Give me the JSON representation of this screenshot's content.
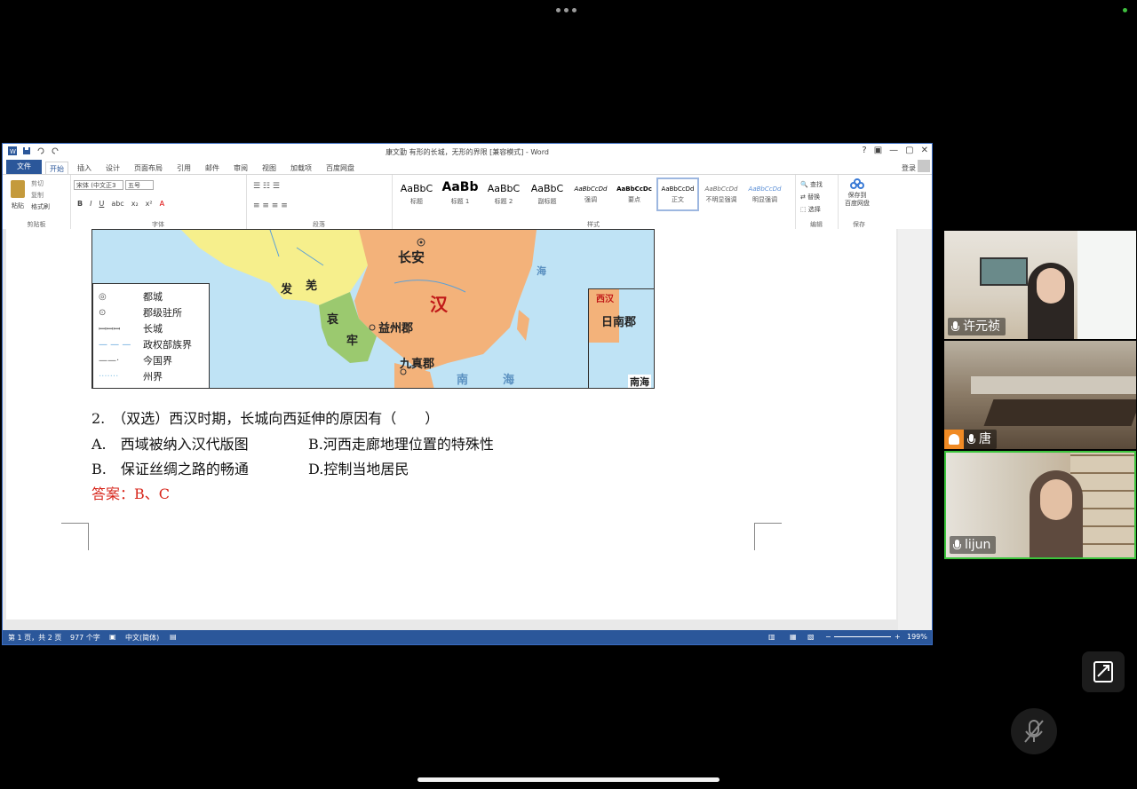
{
  "word": {
    "title": "康文勤 有形的长城，无形的界限 [兼容模式] - Word",
    "window_controls": [
      "?",
      "▣",
      "—",
      "▢",
      "✕"
    ],
    "tabs": [
      "文件",
      "开始",
      "插入",
      "设计",
      "页面布局",
      "引用",
      "邮件",
      "审阅",
      "视图",
      "加载项",
      "百度网盘"
    ],
    "login": "登录",
    "clipboard": {
      "paste": "粘贴",
      "cut": "剪切",
      "copy": "复制",
      "format_painter": "格式刷",
      "group": "剪贴板"
    },
    "font": {
      "name": "宋体 (中文正3",
      "size": "五号",
      "group": "字体"
    },
    "paragraph_group": "段落",
    "styles": [
      {
        "sample": "AaBbC",
        "name": "标题"
      },
      {
        "sample": "AaBb",
        "name": "标题 1"
      },
      {
        "sample": "AaBbC",
        "name": "标题 2"
      },
      {
        "sample": "AaBbC",
        "name": "副标题"
      },
      {
        "sample": "AaBbCcDd",
        "name": "强调"
      },
      {
        "sample": "AaBbCcDc",
        "name": "要点"
      },
      {
        "sample": "AaBbCcDd",
        "name": "正文"
      },
      {
        "sample": "AaBbCcDd",
        "name": "不明显强调"
      },
      {
        "sample": "AaBbCcDd",
        "name": "明显强调"
      }
    ],
    "styles_group": "样式",
    "editing": {
      "find": "查找",
      "replace": "替换",
      "select": "选择",
      "group": "编辑"
    },
    "save": {
      "label_line1": "保存到",
      "label_line2": "百度网盘",
      "group": "保存"
    },
    "map": {
      "legend": [
        "都城",
        "郡级驻所",
        "长城",
        "政权部族界",
        "今国界",
        "州界"
      ],
      "labels": {
        "changan": "长安",
        "han": "汉",
        "fa": "发",
        "qiang": "羌",
        "ai": "哀",
        "lao": "牢",
        "yizhou": "益州郡",
        "jiuzhen": "九真郡",
        "rinan": "日南郡",
        "nanhai": "南海",
        "nan": "南",
        "hai": "海",
        "sea2": "海",
        "inset_han": "西汉"
      }
    },
    "question": {
      "stem": "2.　（双选）西汉时期，长城向西延伸的原因有（　　）",
      "option_a": "A.　西域被纳入汉代版图",
      "option_b_right": "B.河西走廊地理位置的特殊性",
      "option_b_left": "B.　保证丝绸之路的畅通",
      "option_d": "D.控制当地居民",
      "answer": "答案：B、C"
    },
    "status": {
      "page": "第 1 页，共 2 页",
      "words": "977 个字",
      "lang": "中文(简体)",
      "zoom": "199%"
    }
  },
  "participants": [
    {
      "name": "许元祯",
      "mic": "on"
    },
    {
      "name": "唐",
      "mic": "on"
    },
    {
      "name": "lijun",
      "mic": "on",
      "active_speaker": true
    }
  ]
}
